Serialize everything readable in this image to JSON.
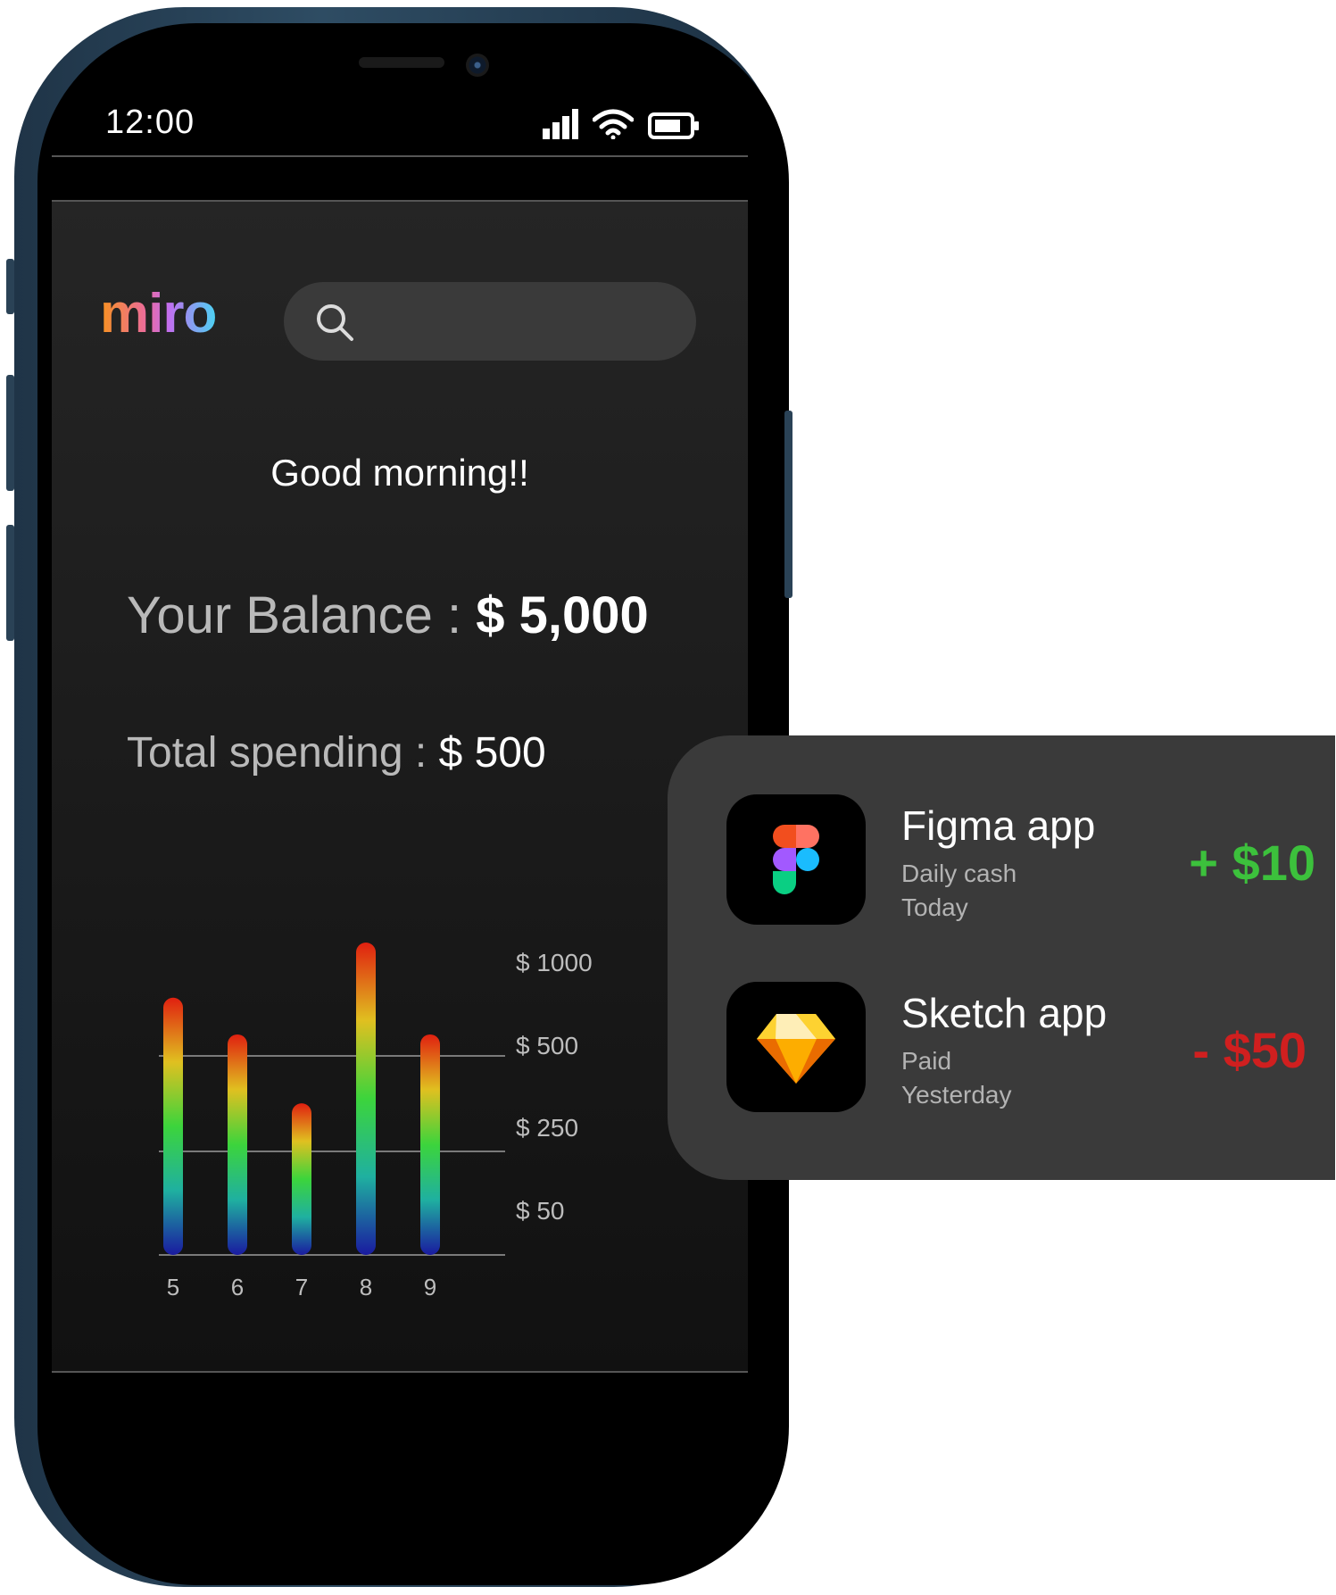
{
  "status_bar": {
    "time": "12:00"
  },
  "header": {
    "logo": "miro",
    "search_placeholder": ""
  },
  "greeting": "Good morning!!",
  "balance": {
    "label": "Your Balance : ",
    "value": "$ 5,000"
  },
  "spending": {
    "label": "Total spending : ",
    "value": "$ 500"
  },
  "chart_data": {
    "type": "bar",
    "categories": [
      "5",
      "6",
      "7",
      "8",
      "9"
    ],
    "values": [
      560,
      480,
      330,
      680,
      480
    ],
    "y_tick_labels": [
      "$ 1000",
      "$ 500",
      "$ 250",
      "$ 50"
    ],
    "y_tick_values": [
      1000,
      500,
      250,
      50
    ],
    "gridlines_at": [
      0,
      250,
      500
    ],
    "ylim": [
      0,
      1000
    ],
    "title": "",
    "xlabel": "",
    "ylabel": "",
    "bar_gradient": [
      "#1a1aa0",
      "#1fb0a0",
      "#3cd43c",
      "#e0c020",
      "#e02010"
    ]
  },
  "transactions": [
    {
      "name": "Figma app",
      "category": "Daily cash",
      "date": "Today",
      "amount": "+ $10",
      "type": "credit",
      "icon": "figma-logo-icon"
    },
    {
      "name": "Sketch app",
      "category": "Paid",
      "date": "Yesterday",
      "amount": "- $50",
      "type": "debit",
      "icon": "sketch-logo-icon"
    }
  ],
  "colors": {
    "credit": "#3cc13c",
    "debit": "#d01f1f",
    "card_bg": "#3a3a3a",
    "screen_bg": "#1b1b1b"
  }
}
